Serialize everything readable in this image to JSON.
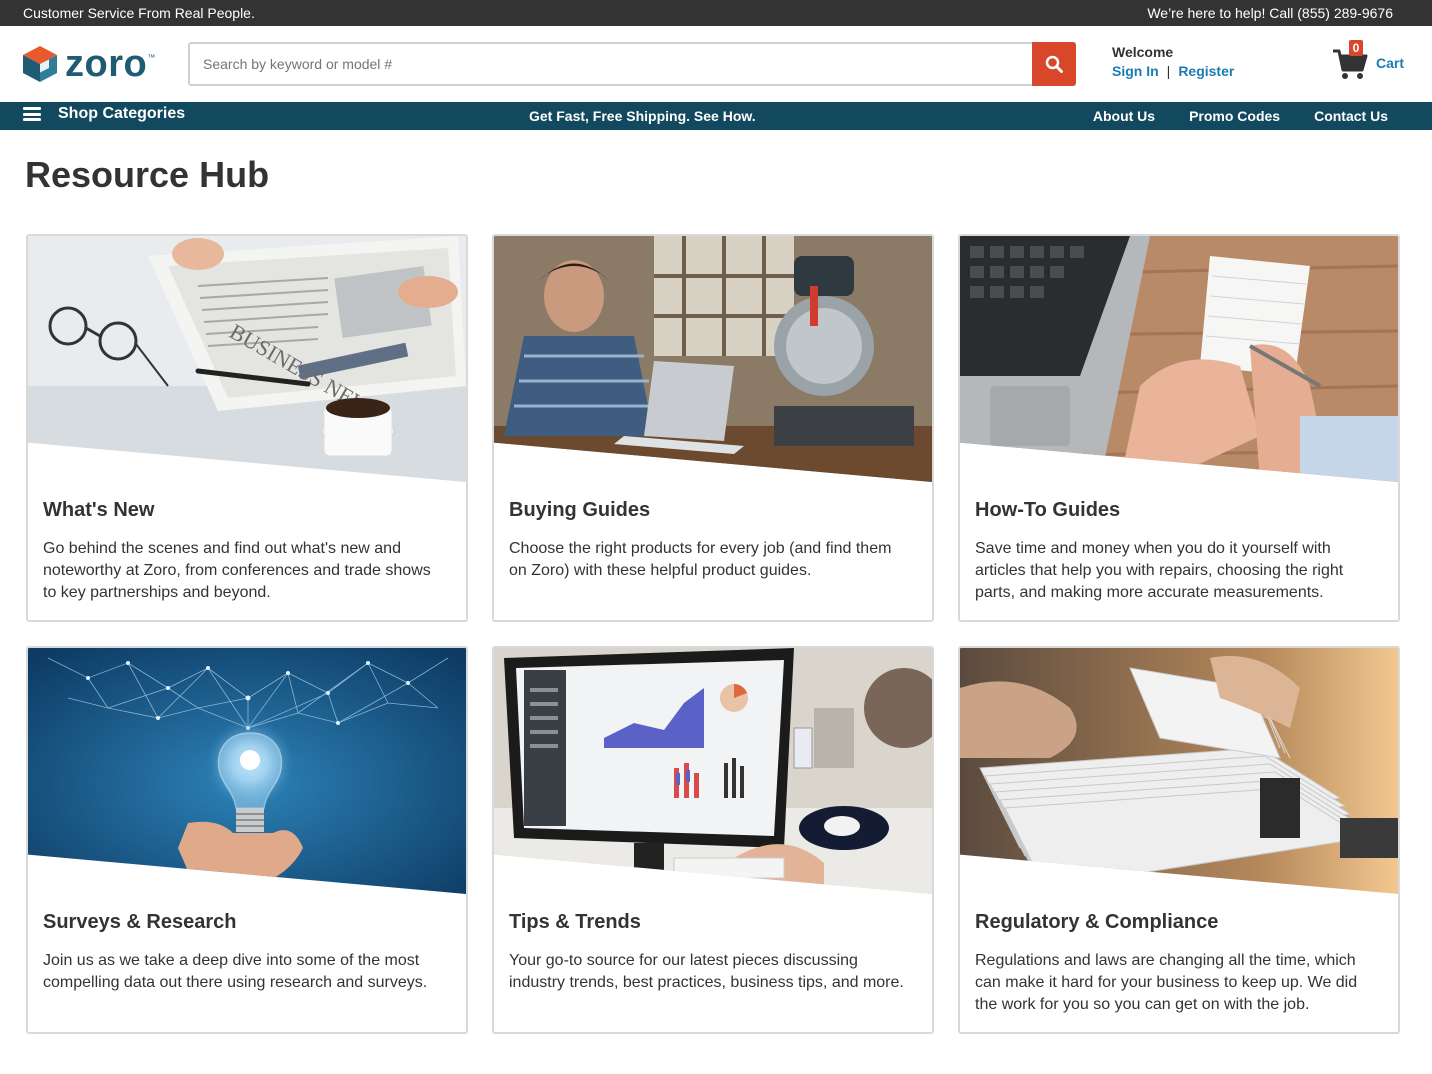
{
  "topbar": {
    "left_text": "Customer Service From Real People.",
    "right_text": "We’re here to help! Call (855) 289-9676"
  },
  "header": {
    "logo_text": "zoro",
    "logo_tm": "™",
    "search_placeholder": "Search by keyword or model #",
    "welcome_title": "Welcome",
    "sign_in": "Sign In",
    "separator": "|",
    "register": "Register",
    "cart_count": "0",
    "cart_label": "Cart"
  },
  "nav": {
    "menu_label": "Shop Categories",
    "promo": "Get Fast, Free Shipping. See How.",
    "links": [
      "About Us",
      "Promo Codes",
      "Contact Us"
    ]
  },
  "page": {
    "title": "Resource Hub"
  },
  "cards": [
    {
      "title": "What's New",
      "desc": "Go behind the scenes and find out what's new and noteworthy at Zoro, from conferences and trade shows to key partnerships and beyond.",
      "image_label": "BUSINESS NEWS"
    },
    {
      "title": "Buying Guides",
      "desc": "Choose the right products for every job (and find them on Zoro) with these helpful product guides."
    },
    {
      "title": "How-To Guides",
      "desc": "Save time and money when you do it yourself with articles that help you with repairs, choosing the right parts, and making more accurate measurements."
    },
    {
      "title": "Surveys & Research",
      "desc": "Join us as we take a deep dive into some of the most compelling data out there using research and surveys."
    },
    {
      "title": "Tips & Trends",
      "desc": "Your go-to source for our latest pieces discussing industry trends, best practices, business tips, and more."
    },
    {
      "title": "Regulatory & Compliance",
      "desc": "Regulations and laws are changing all the time, which can make it hard for your business to keep up. We did the work for you so you can get on with the job."
    }
  ],
  "colors": {
    "accent": "#d9472b",
    "navbar": "#13495e",
    "link": "#1b7bb3",
    "topbar": "#333333"
  },
  "icons": {
    "search": "search-icon",
    "cart": "cart-icon",
    "menu": "hamburger-menu-icon"
  }
}
